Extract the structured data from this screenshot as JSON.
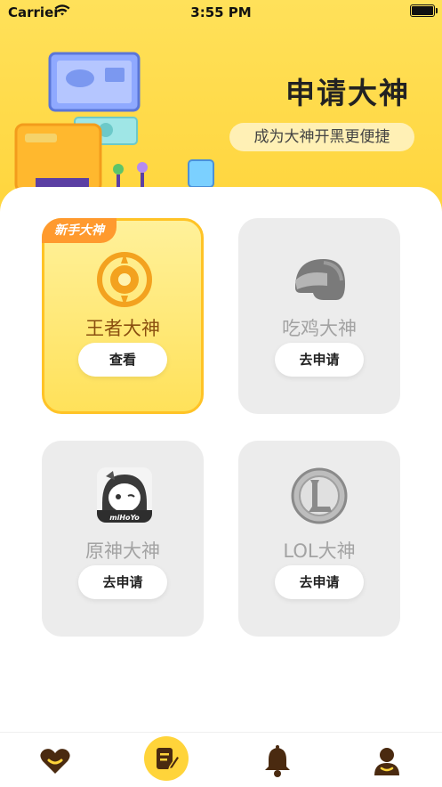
{
  "status_bar": {
    "carrier": "Carrier",
    "time": "3:55 PM"
  },
  "header": {
    "title": "申请大神",
    "subtitle": "成为大神开黑更便捷"
  },
  "cards": [
    {
      "name": "王者大神",
      "button": "查看",
      "tag": "新手大神",
      "icon": "honor-of-kings-icon"
    },
    {
      "name": "吃鸡大神",
      "button": "去申请",
      "icon": "helmet-icon"
    },
    {
      "name": "原神大神",
      "button": "去申请",
      "icon": "genshin-character-icon",
      "icon_text": "miHoYo"
    },
    {
      "name": "LOL大神",
      "button": "去申请",
      "icon": "lol-logo-icon"
    }
  ],
  "tabbar": {
    "items": [
      "heart-icon",
      "edit-icon",
      "bell-icon",
      "user-icon"
    ],
    "active": "edit-icon"
  },
  "colors": {
    "accent": "#ffd43a",
    "active_card_border": "#ffc326",
    "tag": "#ff9a2e",
    "name_active": "#8a4f10",
    "tab_icon": "#4a2a10"
  }
}
